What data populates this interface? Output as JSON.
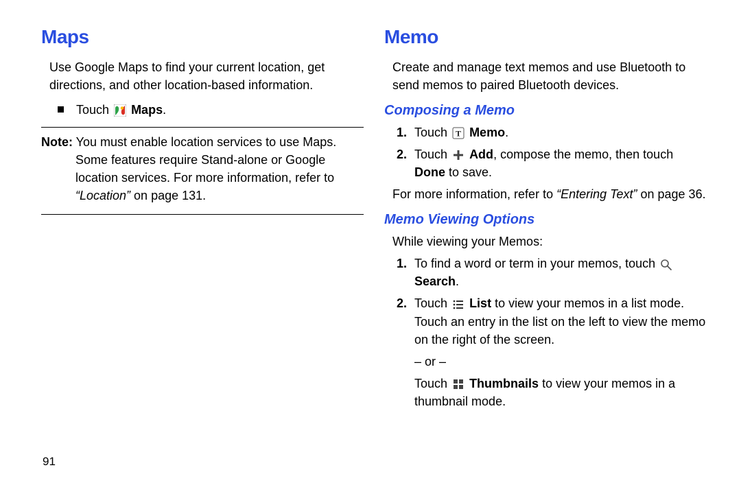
{
  "pageNumber": "91",
  "left": {
    "heading": "Maps",
    "intro": "Use Google Maps to find your current location, get directions, and other location-based information.",
    "bullet_prefix": "Touch ",
    "bullet_bold": "Maps",
    "bullet_suffix": ".",
    "note_label": "Note:",
    "note_body_pre": " You must enable location services to use Maps. Some features require Stand-alone or Google location services. For more information, refer to ",
    "note_ref": "“Location”",
    "note_post": " on page 131."
  },
  "right": {
    "heading": "Memo",
    "intro": "Create and manage text memos and use Bluetooth to send memos to paired Bluetooth devices.",
    "sub1": "Composing a Memo",
    "c1_pre": "Touch ",
    "c1_bold": "Memo",
    "c1_suf": ".",
    "c2_pre": "Touch ",
    "c2_add": "Add",
    "c2_mid": ", compose the memo, then touch ",
    "c2_done": "Done",
    "c2_suf": " to save.",
    "more_pre": "For more information, refer to ",
    "more_ref": "“Entering Text”",
    "more_post": " on page 36.",
    "sub2": "Memo Viewing Options",
    "view_intro": "While viewing your Memos:",
    "v1_pre": "To find a word or term in your memos, touch ",
    "v1_bold": "Search",
    "v1_suf": ".",
    "v2a_pre": "Touch ",
    "v2a_bold": "List",
    "v2a_suf": " to view your memos in a list mode. Touch an entry in the list on the left to view the memo on the right of the screen.",
    "or": "– or –",
    "v2b_pre": "Touch ",
    "v2b_bold": "Thumbnails",
    "v2b_suf": " to view your memos in a thumbnail mode."
  }
}
